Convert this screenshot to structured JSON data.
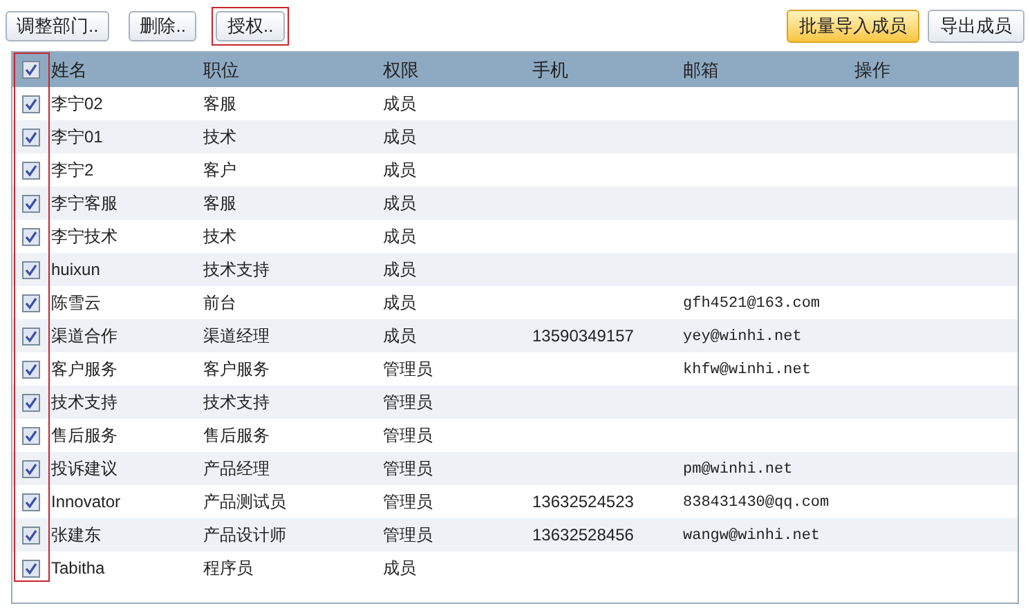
{
  "toolbar": {
    "left_buttons": [
      {
        "label": "调整部门..",
        "highlighted": false
      },
      {
        "label": "删除..",
        "highlighted": false
      },
      {
        "label": "授权..",
        "highlighted": true
      }
    ],
    "right_buttons": [
      {
        "label": "批量导入成员",
        "primary": true
      },
      {
        "label": "导出成员",
        "primary": false
      }
    ]
  },
  "table": {
    "all_checked": true,
    "checkbox_column_highlighted": true,
    "columns": [
      "姓名",
      "职位",
      "权限",
      "手机",
      "邮箱",
      "操作"
    ],
    "rows": [
      {
        "checked": true,
        "name": "李宁02",
        "position": "客服",
        "role": "成员"
      },
      {
        "checked": true,
        "name": "李宁01",
        "position": "技术",
        "role": "成员"
      },
      {
        "checked": true,
        "name": "李宁2",
        "position": "客户",
        "role": "成员"
      },
      {
        "checked": true,
        "name": "李宁客服",
        "position": "客服",
        "role": "成员"
      },
      {
        "checked": true,
        "name": "李宁技术",
        "position": "技术",
        "role": "成员"
      },
      {
        "checked": true,
        "name": "huixun",
        "position": "技术支持",
        "role": "成员"
      },
      {
        "checked": true,
        "name": "陈雪云",
        "position": "前台",
        "role": "成员",
        "email": "gfh4521@163.com"
      },
      {
        "checked": true,
        "name": "渠道合作",
        "position": "渠道经理",
        "role": "成员",
        "phone": "13590349157",
        "email": "yey@winhi.net"
      },
      {
        "checked": true,
        "name": "客户服务",
        "position": "客户服务",
        "role": "管理员",
        "email": "khfw@winhi.net"
      },
      {
        "checked": true,
        "name": "技术支持",
        "position": "技术支持",
        "role": "管理员"
      },
      {
        "checked": true,
        "name": "售后服务",
        "position": "售后服务",
        "role": "管理员"
      },
      {
        "checked": true,
        "name": "投诉建议",
        "position": "产品经理",
        "role": "管理员",
        "email": "pm@winhi.net"
      },
      {
        "checked": true,
        "name": "Innovator",
        "position": "产品测试员",
        "role": "管理员",
        "phone": "13632524523",
        "email": "838431430@qq.com"
      },
      {
        "checked": true,
        "name": "张建东",
        "position": "产品设计师",
        "role": "管理员",
        "phone": "13632528456",
        "email": "wangw@winhi.net"
      },
      {
        "checked": true,
        "name": "Tabitha",
        "position": "程序员",
        "role": "成员"
      }
    ]
  }
}
